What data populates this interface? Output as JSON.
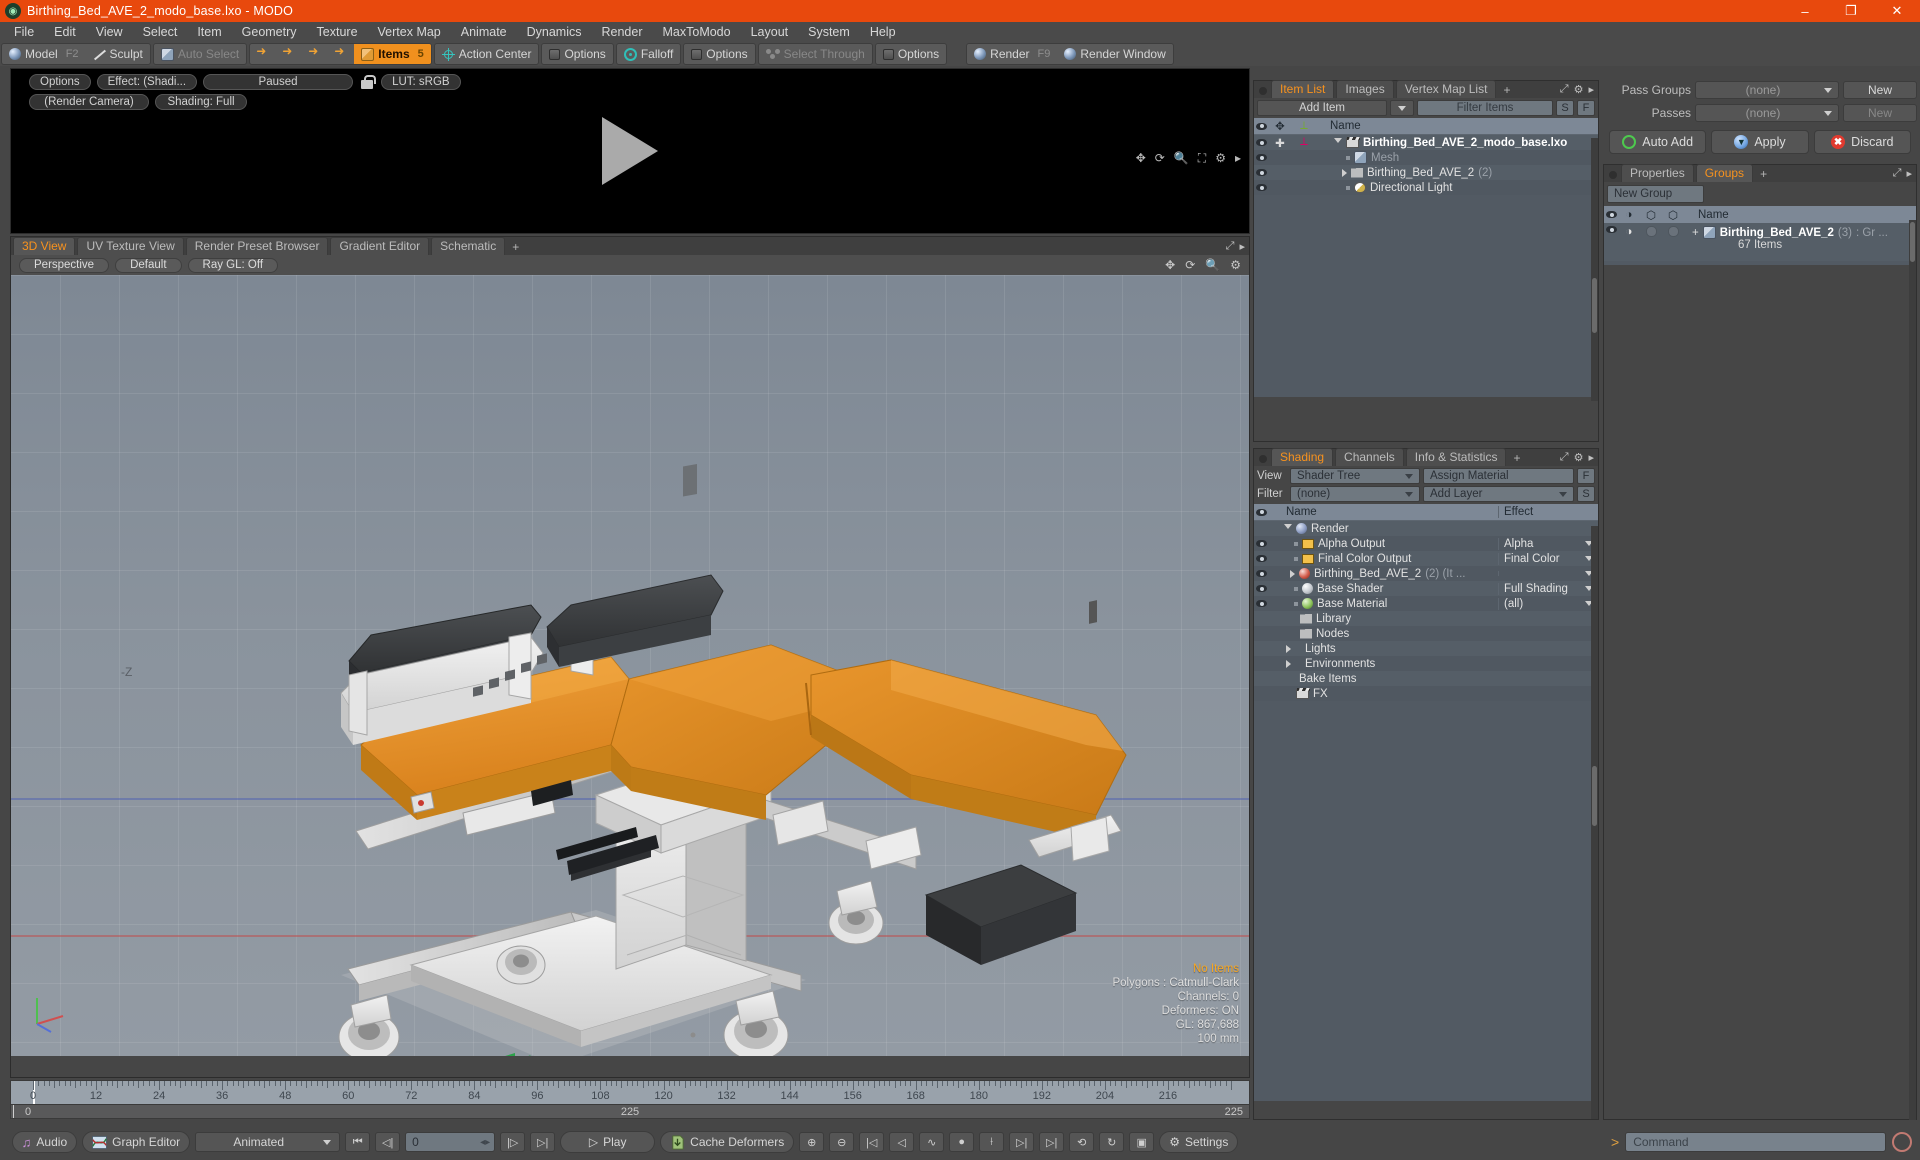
{
  "window": {
    "title": "Birthing_Bed_AVE_2_modo_base.lxo - MODO",
    "minimize": "–",
    "maximize": "❐",
    "close": "✕"
  },
  "menu": [
    "File",
    "Edit",
    "View",
    "Select",
    "Item",
    "Geometry",
    "Texture",
    "Vertex Map",
    "Animate",
    "Dynamics",
    "Render",
    "MaxToModo",
    "Layout",
    "System",
    "Help"
  ],
  "toolbar": {
    "mode_model": "Model",
    "mode_model_key": "F2",
    "mode_sculpt": "Sculpt",
    "auto_select": "Auto Select",
    "items": "Items",
    "items_badge": "5",
    "action_center": "Action Center",
    "options1": "Options",
    "falloff": "Falloff",
    "options2": "Options",
    "select_through": "Select Through",
    "options3": "Options",
    "render": "Render",
    "render_key": "F9",
    "render_window": "Render Window"
  },
  "render_preview": {
    "options": "Options",
    "effect": "Effect: (Shadi...",
    "paused": "Paused",
    "lut": "LUT: sRGB",
    "camera": "(Render Camera)",
    "shading": "Shading: Full"
  },
  "viewport": {
    "tabs": [
      "3D View",
      "UV Texture View",
      "Render Preset Browser",
      "Gradient Editor",
      "Schematic"
    ],
    "tabs_plus": "+",
    "active_tab": "3D View",
    "controls": [
      "Perspective",
      "Default",
      "Ray GL: Off"
    ],
    "axis_label": "-Z",
    "stats": {
      "selection": "No Items",
      "polygons": "Polygons : Catmull-Clark",
      "channels": "Channels: 0",
      "deformers": "Deformers: ON",
      "gl": "GL: 867,688",
      "scale": "100 mm"
    }
  },
  "timeline": {
    "ticks": [
      "0",
      "12",
      "24",
      "36",
      "48",
      "60",
      "72",
      "84",
      "96",
      "108",
      "120",
      "132",
      "144",
      "156",
      "168",
      "180",
      "192",
      "204",
      "216"
    ],
    "range_start": "0",
    "range_end": "225",
    "range_end2": "225",
    "current_frame": "0"
  },
  "bottombar": {
    "audio": "Audio",
    "graph_editor": "Graph Editor",
    "animated": "Animated",
    "frame_value": "0",
    "play": "Play",
    "cache_deformers": "Cache Deformers",
    "settings": "Settings",
    "transport": {
      "first": "⏮",
      "prev": "◁",
      "next": "▷",
      "last": "⏭"
    }
  },
  "item_list": {
    "tabs": [
      "Item List",
      "Images",
      "Vertex Map List"
    ],
    "tabs_plus": "+",
    "active_tab": "Item List",
    "add_item": "Add Item",
    "filter_items": "Filter Items",
    "btn_s": "S",
    "btn_f": "F",
    "col_name": "Name",
    "rows": [
      {
        "name": "Birthing_Bed_AVE_2_modo_base.lxo",
        "suffix": "",
        "icon": "scene-icon",
        "indent": 1,
        "bold": true,
        "expander": "down"
      },
      {
        "name": "Mesh",
        "suffix": "",
        "icon": "mesh-icon",
        "indent": 2,
        "bold": false,
        "expander": "leaf",
        "dim": true
      },
      {
        "name": "Birthing_Bed_AVE_2",
        "suffix": "(2)",
        "icon": "group-icon",
        "indent": 2,
        "bold": false,
        "expander": "right"
      },
      {
        "name": "Directional Light",
        "suffix": "",
        "icon": "light-icon",
        "indent": 2,
        "bold": false,
        "expander": "leaf"
      }
    ]
  },
  "pass_groups": {
    "label_pass_groups": "Pass Groups",
    "value_pass_groups": "(none)",
    "new_pass_groups": "New",
    "label_passes": "Passes",
    "value_passes": "(none)",
    "new_passes": "New",
    "auto_add": "Auto Add",
    "apply": "Apply",
    "discard": "Discard"
  },
  "groups_panel": {
    "tabs": [
      "Properties",
      "Groups"
    ],
    "tabs_plus": "+",
    "active_tab": "Groups",
    "new_group": "New Group",
    "col_name": "Name",
    "row": {
      "name": "Birthing_Bed_AVE_2",
      "count": "(3)",
      "suffix": ": Gr ...",
      "sub": "67 Items",
      "expander": "+"
    }
  },
  "shading": {
    "tabs": [
      "Shading",
      "Channels",
      "Info & Statistics"
    ],
    "tabs_plus": "+",
    "active_tab": "Shading",
    "label_view": "View",
    "value_view": "Shader Tree",
    "assign_material": "Assign Material",
    "btn_f": "F",
    "label_filter": "Filter",
    "value_filter": "(none)",
    "add_layer": "Add Layer",
    "btn_s": "S",
    "col_name": "Name",
    "col_effect": "Effect",
    "rows": [
      {
        "name": "Render",
        "effect": "",
        "icon": "render-ball-icon",
        "indent": 1,
        "expander": "down",
        "eye": false
      },
      {
        "name": "Alpha Output",
        "effect": "Alpha",
        "icon": "image-icon",
        "indent": 2,
        "expander": "leaf",
        "eye": true
      },
      {
        "name": "Final Color Output",
        "effect": "Final Color",
        "icon": "image-icon",
        "indent": 2,
        "expander": "leaf",
        "eye": true
      },
      {
        "name": "Birthing_Bed_AVE_2",
        "suffix": "(2) (It ...",
        "effect": "",
        "icon": "material-red-icon",
        "indent": 2,
        "expander": "right",
        "eye": true
      },
      {
        "name": "Base Shader",
        "effect": "Full Shading",
        "icon": "shader-ball-icon",
        "indent": 2,
        "expander": "leaf",
        "eye": true
      },
      {
        "name": "Base Material",
        "effect": "(all)",
        "icon": "material-green-icon",
        "indent": 2,
        "expander": "leaf",
        "eye": true
      },
      {
        "name": "Library",
        "effect": "",
        "icon": "folder-icon",
        "indent": 2,
        "expander": "none",
        "eye": false
      },
      {
        "name": "Nodes",
        "effect": "",
        "icon": "folder-icon",
        "indent": 2,
        "expander": "none",
        "eye": false
      },
      {
        "name": "Lights",
        "effect": "",
        "icon": "none",
        "indent": 1,
        "expander": "right",
        "eye": false
      },
      {
        "name": "Environments",
        "effect": "",
        "icon": "none",
        "indent": 1,
        "expander": "right",
        "eye": false
      },
      {
        "name": "Bake Items",
        "effect": "",
        "icon": "none",
        "indent": 1,
        "expander": "none",
        "eye": false
      },
      {
        "name": "FX",
        "effect": "",
        "icon": "clapper-icon",
        "indent": 1,
        "expander": "none",
        "eye": false
      }
    ]
  },
  "command_bar": {
    "prompt": ">",
    "placeholder": "Command"
  },
  "colors": {
    "accent": "#f7921e",
    "titlebar": "#e8490d",
    "panel": "#464646",
    "list": "#555e67",
    "model_orange": "#e8942a"
  }
}
